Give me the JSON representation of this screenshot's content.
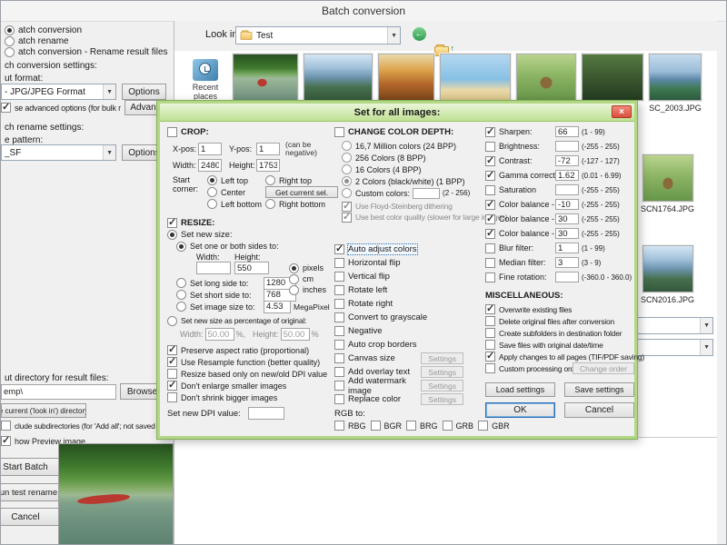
{
  "window": {
    "title": "Batch conversion"
  },
  "icons": {
    "caret": "▼",
    "back": "←",
    "up": "↑",
    "star": "★",
    "close": "×"
  },
  "colors": {
    "dialog_border": "#b2d886",
    "dialog_title_bg": "#bfe093",
    "close_red": "#d94f3d"
  },
  "left_panel": {
    "modes": [
      {
        "label": "atch conversion",
        "selected": true
      },
      {
        "label": "atch rename",
        "selected": false
      },
      {
        "label": "atch conversion - Rename result files",
        "selected": false
      }
    ],
    "settings_header": "ch conversion settings:",
    "format_label": "ut format:",
    "format_value": "- JPG/JPEG Format",
    "format_options": "Options",
    "advanced_label": "se advanced options (for bulk resize...)",
    "advanced_checked": true,
    "advanced_button": "Advanc",
    "rename_header": "ch rename settings:",
    "pattern_label": "e pattern:",
    "pattern_value": "_SF",
    "pattern_options": "Options",
    "output_label": "ut directory for result files:",
    "output_value": "emp\\",
    "browse_button": "Browse",
    "use_current_button": "e current ('look in') directory",
    "subdirs_label": "clude subdirectories (for 'Add all'; not saved on exit)",
    "subdirs_checked": false,
    "preview_label": "how Preview image",
    "preview_checked": true,
    "start_button": "Start Batch",
    "test_button": "Run test rename",
    "cancel_button": "Cancel"
  },
  "browser": {
    "look_in_label": "Look in:",
    "folder_name": "Test",
    "recent_places": "Recent places",
    "strip": [
      {
        "look": "canoe"
      },
      {
        "look": "mountain"
      },
      {
        "look": "autumn"
      },
      {
        "look": "beach"
      },
      {
        "look": "dog"
      },
      {
        "look": "forest"
      },
      {
        "look": "alps",
        "name": "SC_2003.JPG"
      }
    ],
    "files": [
      {
        "look": "dog",
        "name": "SCN1764.JPG"
      },
      {
        "look": "mountain",
        "name": "SCN2016.JPG"
      }
    ]
  },
  "dialog": {
    "title": "Set for all images:",
    "crop": {
      "header": "CROP:",
      "checked": false,
      "xpos_label": "X-pos:",
      "xpos": "1",
      "ypos_label": "Y-pos:",
      "ypos": "1",
      "note1": "(can be",
      "note2": "negative)",
      "width_label": "Width:",
      "width": "2480",
      "height_label": "Height:",
      "height": "1753",
      "start_label1": "Start",
      "start_label2": "corner:",
      "corners": [
        {
          "label": "Left top",
          "selected": true
        },
        {
          "label": "Right top",
          "selected": false
        },
        {
          "label": "Center",
          "selected": false
        },
        {
          "label": "Left bottom",
          "selected": false
        },
        {
          "label": "Right bottom",
          "selected": false
        }
      ],
      "get_current_button": "Get current sel."
    },
    "resize": {
      "header": "RESIZE:",
      "checked": true,
      "set_new_size": {
        "label": "Set new size:",
        "selected": true
      },
      "one_or_both": {
        "label": "Set one or both sides to:",
        "selected": true
      },
      "width_label": "Width:",
      "width_value": "",
      "height_label": "Height:",
      "height_value": "550",
      "units": [
        {
          "label": "pixels",
          "selected": true
        },
        {
          "label": "cm",
          "selected": false
        },
        {
          "label": "inches",
          "selected": false
        }
      ],
      "long_side": {
        "label": "Set long side to:",
        "value": "1280",
        "selected": false
      },
      "short_side": {
        "label": "Set short side to:",
        "value": "768",
        "selected": false
      },
      "image_size": {
        "label": "Set image size to:",
        "value": "4.53",
        "unit": "MegaPixel",
        "selected": false
      },
      "percentage": {
        "label": "Set new size as percentage of original:",
        "selected": false
      },
      "pct_width_label": "Width:",
      "pct_width": "50.00",
      "pct_w_unit": "%,",
      "pct_height_label": "Height:",
      "pct_height": "50.00",
      "pct_h_unit": "%",
      "options": [
        {
          "label": "Preserve aspect ratio (proportional)",
          "checked": true
        },
        {
          "label": "Use Resample function (better quality)",
          "checked": true
        },
        {
          "label": "Resize based only on new/old DPI value",
          "checked": false
        },
        {
          "label": "Don't enlarge smaller images",
          "checked": true
        },
        {
          "label": "Don't shrink bigger images",
          "checked": false
        }
      ],
      "dpi_label": "Set new DPI value:",
      "dpi_value": ""
    },
    "color_depth": {
      "header": "CHANGE COLOR DEPTH:",
      "checked": false,
      "options": [
        {
          "label": "16,7 Million colors (24 BPP)",
          "selected": false
        },
        {
          "label": "256 Colors (8 BPP)",
          "selected": false
        },
        {
          "label": "16 Colors (4 BPP)",
          "selected": false
        },
        {
          "label": "2 Colors (black/white) (1 BPP)",
          "selected": true
        }
      ],
      "custom_label": "Custom colors:",
      "custom_value": "",
      "custom_range": "(2 - 256)",
      "dither": {
        "label": "Use Floyd-Steinberg dithering",
        "checked": true
      },
      "best": {
        "label": "Use best color quality (slower for large images)",
        "checked": true
      }
    },
    "transforms": [
      {
        "label": "Auto adjust colors",
        "checked": true,
        "focused": true
      },
      {
        "label": "Horizontal flip",
        "checked": false
      },
      {
        "label": "Vertical flip",
        "checked": false
      },
      {
        "label": "Rotate left",
        "checked": false
      },
      {
        "label": "Rotate right",
        "checked": false
      },
      {
        "label": "Convert to grayscale",
        "checked": false
      },
      {
        "label": "Negative",
        "checked": false
      },
      {
        "label": "Auto crop borders",
        "checked": false
      },
      {
        "label": "Canvas size",
        "checked": false,
        "settings": "Settings"
      },
      {
        "label": "Add overlay text",
        "checked": false,
        "settings": "Settings"
      },
      {
        "label": "Add watermark image",
        "checked": false,
        "settings": "Settings"
      },
      {
        "label": "Replace color",
        "checked": false,
        "settings": "Settings"
      }
    ],
    "rgb_to": {
      "label": "RGB to:",
      "options": [
        "RBG",
        "BGR",
        "BRG",
        "GRB",
        "GBR"
      ]
    },
    "adjustments": [
      {
        "label": "Sharpen:",
        "checked": true,
        "value": "66",
        "range": "(1 - 99)"
      },
      {
        "label": "Brightness:",
        "checked": false,
        "value": "",
        "range": "(-255 - 255)"
      },
      {
        "label": "Contrast:",
        "checked": true,
        "value": "-72",
        "range": "(-127 - 127)"
      },
      {
        "label": "Gamma correction:",
        "checked": true,
        "value": "1.62",
        "range": "(0.01 - 6.99)"
      },
      {
        "label": "Saturation",
        "checked": false,
        "value": "",
        "range": "(-255 - 255)"
      },
      {
        "label": "Color balance - R:",
        "checked": true,
        "value": "-10",
        "range": "(-255 - 255)"
      },
      {
        "label": "Color balance - G:",
        "checked": true,
        "value": "30",
        "range": "(-255 - 255)"
      },
      {
        "label": "Color balance - B:",
        "checked": true,
        "value": "30",
        "range": "(-255 - 255)"
      },
      {
        "label": "Blur filter:",
        "checked": false,
        "value": "1",
        "range": "(1 - 99)"
      },
      {
        "label": "Median filter:",
        "checked": false,
        "value": "3",
        "range": "(3 - 9)"
      },
      {
        "label": "Fine rotation:",
        "checked": false,
        "value": "",
        "range": "(-360.0 - 360.0)"
      }
    ],
    "misc": {
      "header": "MISCELLANEOUS:",
      "options": [
        {
          "label": "Overwrite existing files",
          "checked": true
        },
        {
          "label": "Delete original files after conversion",
          "checked": false
        },
        {
          "label": "Create subfolders in destination folder",
          "checked": false
        },
        {
          "label": "Save files with original date/time",
          "checked": false
        },
        {
          "label": "Apply changes to all pages (TIF/PDF saving)",
          "checked": true
        },
        {
          "label": "Custom processing order",
          "checked": false,
          "button": "Change order"
        }
      ]
    },
    "buttons": {
      "load": "Load settings",
      "save": "Save settings",
      "ok": "OK",
      "cancel": "Cancel"
    }
  }
}
